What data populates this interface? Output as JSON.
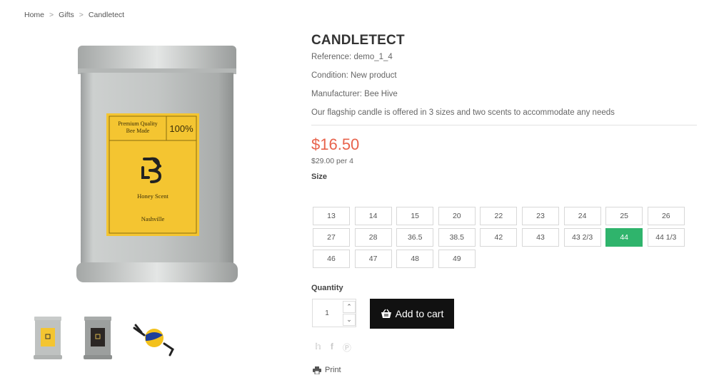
{
  "breadcrumb": {
    "home": "Home",
    "gifts": "Gifts",
    "current": "Candletect",
    "sep": ">"
  },
  "product": {
    "title": "CANDLETECT",
    "reference": "Reference: demo_1_4",
    "condition": "Condition: New product",
    "manufacturer": "Manufacturer: Bee Hive",
    "description": "Our flagship candle is offered in 3 sizes and two scents to accommodate any needs",
    "price": "$16.50",
    "unit_price": "$29.00 per 4",
    "label": {
      "quality": "Premium Quality Bee Made",
      "percent": "100%",
      "scent": "Honey Scent",
      "city": "Nashville"
    }
  },
  "size": {
    "label": "Size",
    "options": [
      "13",
      "14",
      "15",
      "20",
      "22",
      "23",
      "24",
      "25",
      "26",
      "27",
      "28",
      "36.5",
      "38.5",
      "42",
      "43",
      "43 2/3",
      "44",
      "44 1/3",
      "46",
      "47",
      "48",
      "49"
    ],
    "selected": "44"
  },
  "quantity": {
    "label": "Quantity",
    "value": "1"
  },
  "cart": {
    "label": "Add to cart"
  },
  "social": [
    "twitter-icon",
    "facebook-icon",
    "pinterest-icon"
  ],
  "print": {
    "label": "Print"
  },
  "colors": {
    "price": "#e8634c",
    "selected_size": "#2fb46c",
    "button": "#111111",
    "label_bg": "#f4c531"
  }
}
